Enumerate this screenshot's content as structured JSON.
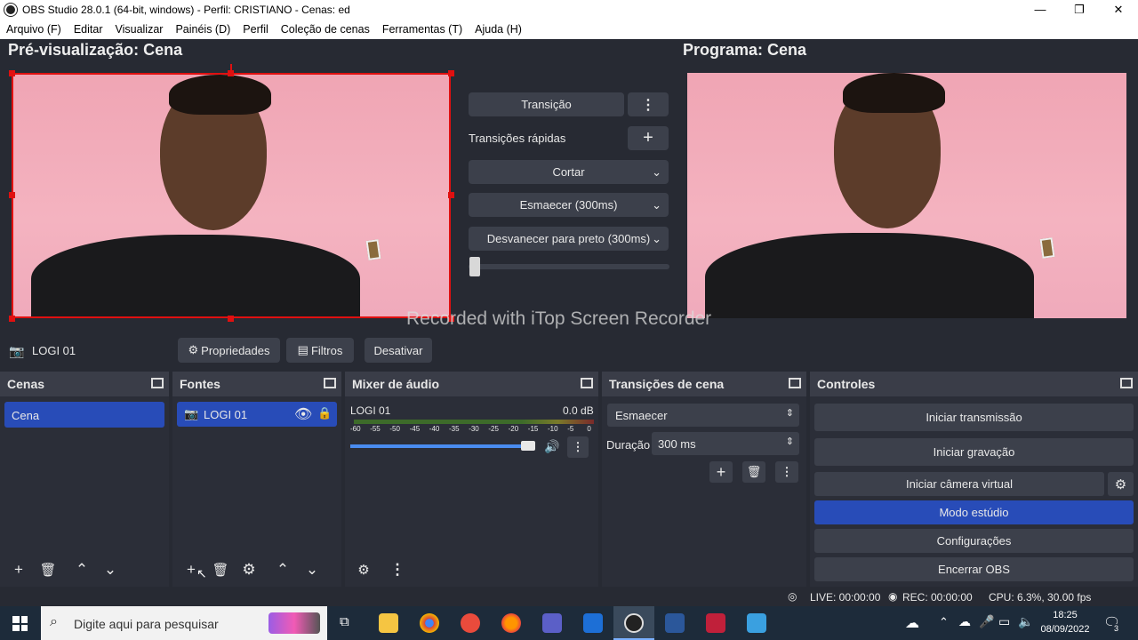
{
  "window": {
    "title": "OBS Studio 28.0.1 (64-bit, windows) - Perfil: CRISTIANO - Cenas: ed",
    "min": "—",
    "max": "❐",
    "close": "✕"
  },
  "menu": [
    "Arquivo (F)",
    "Editar",
    "Visualizar",
    "Painéis (D)",
    "Perfil",
    "Coleção de cenas",
    "Ferramentas (T)",
    "Ajuda (H)"
  ],
  "preview": {
    "title": "Pré-visualização: Cena"
  },
  "program": {
    "title": "Programa: Cena"
  },
  "transition": {
    "button": "Transição",
    "quick_label": "Transições rápidas",
    "items": [
      "Cortar",
      "Esmaecer (300ms)",
      "Desvanecer para preto (300ms)"
    ],
    "slider_level": 0
  },
  "watermark": "Recorded with iTop Screen Recorder",
  "source_toolbar": {
    "source_name": "LOGI 01",
    "properties": "Propriedades",
    "filters": "Filtros",
    "disable": "Desativar"
  },
  "scenes": {
    "title": "Cenas",
    "items": [
      "Cena"
    ]
  },
  "sources": {
    "title": "Fontes",
    "items": [
      "LOGI 01"
    ]
  },
  "mixer": {
    "title": "Mixer de áudio",
    "channel": "LOGI 01",
    "level": "0.0 dB",
    "scale": [
      "-60",
      "-55",
      "-50",
      "-45",
      "-40",
      "-35",
      "-30",
      "-25",
      "-20",
      "-15",
      "-10",
      "-5",
      "0"
    ],
    "volume_fraction": 1.0
  },
  "scene_transitions": {
    "title": "Transições de cena",
    "selected": "Esmaecer",
    "duration_label": "Duração",
    "duration_value": "300 ms"
  },
  "controls": {
    "title": "Controles",
    "buttons": [
      "Iniciar transmissão",
      "Iniciar gravação",
      "Iniciar câmera virtual",
      "Modo estúdio",
      "Configurações",
      "Encerrar OBS"
    ]
  },
  "status": {
    "live": "LIVE: 00:00:00",
    "rec": "REC: 00:00:00",
    "cpu": "CPU: 6.3%, 30.00 fps"
  },
  "taskbar": {
    "search_placeholder": "Digite aqui para pesquisar",
    "time": "18:25",
    "date": "08/09/2022",
    "notif_count": "3"
  },
  "colors": {
    "accent": "#284cb8",
    "bg": "#272a33",
    "panel": "#2b2e38",
    "button": "#3c404b",
    "selection_red": "#e01010"
  }
}
